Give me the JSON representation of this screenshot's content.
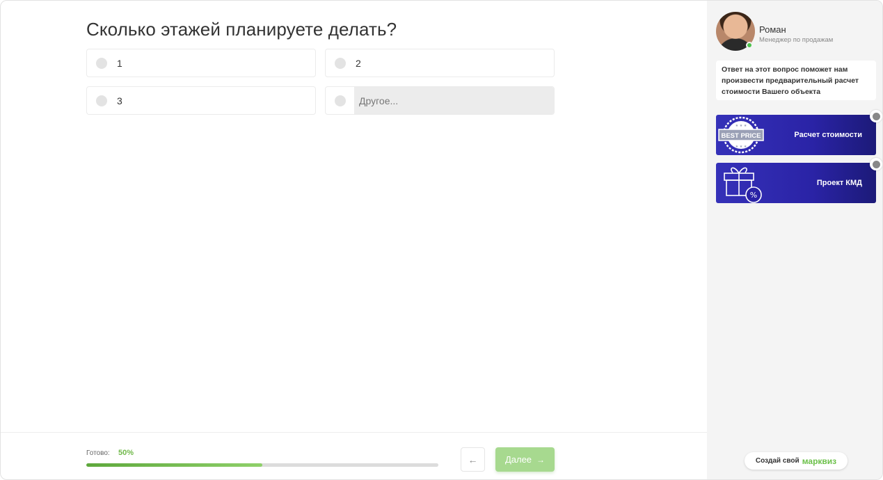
{
  "question": {
    "title": "Сколько этажей планируете делать?",
    "options": [
      {
        "label": "1"
      },
      {
        "label": "2"
      },
      {
        "label": "3"
      }
    ],
    "other_placeholder": "Другое..."
  },
  "footer": {
    "progress_label": "Готово:",
    "progress_text": "50%",
    "progress_value": 0.5,
    "next_label": "Далее"
  },
  "sidebar": {
    "manager_name": "Роман",
    "manager_role": "Менеджер по продажам",
    "note": "Ответ на этот вопрос поможет нам произвести предварительный расчет стоимости Вашего объекта",
    "bonuses": [
      {
        "label": "Расчет стоимости",
        "icon": "best-price-badge-icon",
        "badge_text": "BEST PRICE"
      },
      {
        "label": "Проект КМД",
        "icon": "gift-percent-icon"
      }
    ],
    "brand_text": "Создай свой",
    "brand_logo": "марквиз"
  },
  "colors": {
    "accent_green": "#71b94b",
    "next_button": "#a7d98f",
    "bonus_blue": "#2a23a6"
  }
}
